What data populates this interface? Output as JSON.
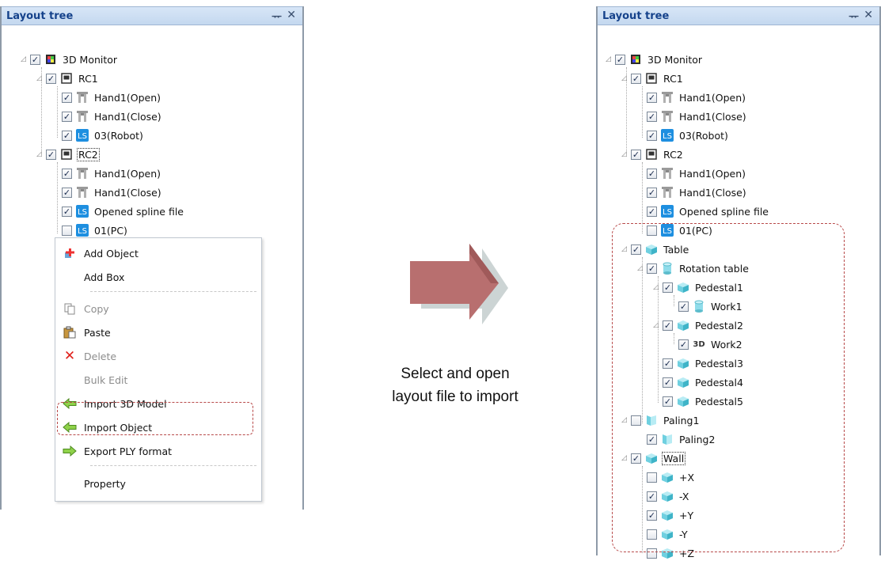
{
  "left_panel": {
    "title": "Layout tree",
    "pin_glyph": "ᅲ",
    "close_glyph": "✕",
    "nodes": [
      {
        "label": "3D Monitor",
        "icon": "monitor-icon",
        "checked": true
      },
      {
        "label": "RC1",
        "icon": "controller-icon",
        "checked": true
      },
      {
        "label": "Hand1(Open)",
        "icon": "hand-icon",
        "checked": true
      },
      {
        "label": "Hand1(Close)",
        "icon": "hand-icon",
        "checked": true
      },
      {
        "label": "03(Robot)",
        "icon": "spline-icon",
        "checked": true
      },
      {
        "label": "RC2",
        "icon": "controller-icon",
        "checked": true
      },
      {
        "label": "Hand1(Open)",
        "icon": "hand-icon",
        "checked": true
      },
      {
        "label": "Hand1(Close)",
        "icon": "hand-icon",
        "checked": true
      },
      {
        "label": "Opened spline file",
        "icon": "spline-icon",
        "checked": true
      },
      {
        "label": "01(PC)",
        "icon": "spline-icon",
        "checked": false
      }
    ]
  },
  "context_menu": {
    "items": [
      {
        "label": "Add Object",
        "icon": "add-object-icon",
        "enabled": true
      },
      {
        "label": "Add Box",
        "icon": "",
        "enabled": true
      },
      {
        "label": "Copy",
        "icon": "copy-icon",
        "enabled": false
      },
      {
        "label": "Paste",
        "icon": "paste-icon",
        "enabled": true
      },
      {
        "label": "Delete",
        "icon": "delete-icon",
        "enabled": false
      },
      {
        "label": "Bulk Edit",
        "icon": "",
        "enabled": false
      },
      {
        "label": "Import 3D Model",
        "icon": "import-arrow-icon",
        "enabled": true
      },
      {
        "label": "Import Object",
        "icon": "import-arrow-icon",
        "enabled": true
      },
      {
        "label": "Export PLY format",
        "icon": "export-arrow-icon",
        "enabled": true
      },
      {
        "label": "Property",
        "icon": "",
        "enabled": true
      }
    ]
  },
  "caption": {
    "line1": "Select and open",
    "line2": "layout file to import"
  },
  "right_panel": {
    "title": "Layout tree",
    "pin_glyph": "ᅲ",
    "close_glyph": "✕",
    "nodes": [
      {
        "label": "3D Monitor",
        "icon": "monitor-icon",
        "checked": true
      },
      {
        "label": "RC1",
        "icon": "controller-icon",
        "checked": true
      },
      {
        "label": "Hand1(Open)",
        "icon": "hand-icon",
        "checked": true
      },
      {
        "label": "Hand1(Close)",
        "icon": "hand-icon",
        "checked": true
      },
      {
        "label": "03(Robot)",
        "icon": "spline-icon",
        "checked": true
      },
      {
        "label": "RC2",
        "icon": "controller-icon",
        "checked": true
      },
      {
        "label": "Hand1(Open)",
        "icon": "hand-icon",
        "checked": true
      },
      {
        "label": "Hand1(Close)",
        "icon": "hand-icon",
        "checked": true
      },
      {
        "label": "Opened spline file",
        "icon": "spline-icon",
        "checked": true
      },
      {
        "label": "01(PC)",
        "icon": "spline-icon",
        "checked": false
      },
      {
        "label": "Table",
        "icon": "box-icon",
        "checked": true
      },
      {
        "label": "Rotation table",
        "icon": "cylinder-icon",
        "checked": true
      },
      {
        "label": "Pedestal1",
        "icon": "box-icon",
        "checked": true
      },
      {
        "label": "Work1",
        "icon": "cylinder-icon",
        "checked": true
      },
      {
        "label": "Pedestal2",
        "icon": "box-icon",
        "checked": true
      },
      {
        "label": "Work2",
        "icon": "3d-model-icon",
        "checked": true,
        "prefix": "3D"
      },
      {
        "label": "Pedestal3",
        "icon": "box-icon",
        "checked": true
      },
      {
        "label": "Pedestal4",
        "icon": "box-icon",
        "checked": true
      },
      {
        "label": "Pedestal5",
        "icon": "box-icon",
        "checked": true
      },
      {
        "label": "Paling1",
        "icon": "paling-icon",
        "checked": false
      },
      {
        "label": "Paling2",
        "icon": "paling-icon",
        "checked": true
      },
      {
        "label": "Wall",
        "icon": "box-icon",
        "checked": true
      },
      {
        "label": "+X",
        "icon": "box-icon",
        "checked": false
      },
      {
        "label": "-X",
        "icon": "box-icon",
        "checked": true
      },
      {
        "label": "+Y",
        "icon": "box-icon",
        "checked": true
      },
      {
        "label": "-Y",
        "icon": "box-icon",
        "checked": false
      },
      {
        "label": "+Z",
        "icon": "box-icon",
        "checked": false
      }
    ]
  },
  "colors": {
    "title_text": "#15428b",
    "arrow": "#b86f6f",
    "highlight_dash": "#b84a4a",
    "spline_blue": "#1e8fe0",
    "box_cyan": "#6fd0e0"
  }
}
